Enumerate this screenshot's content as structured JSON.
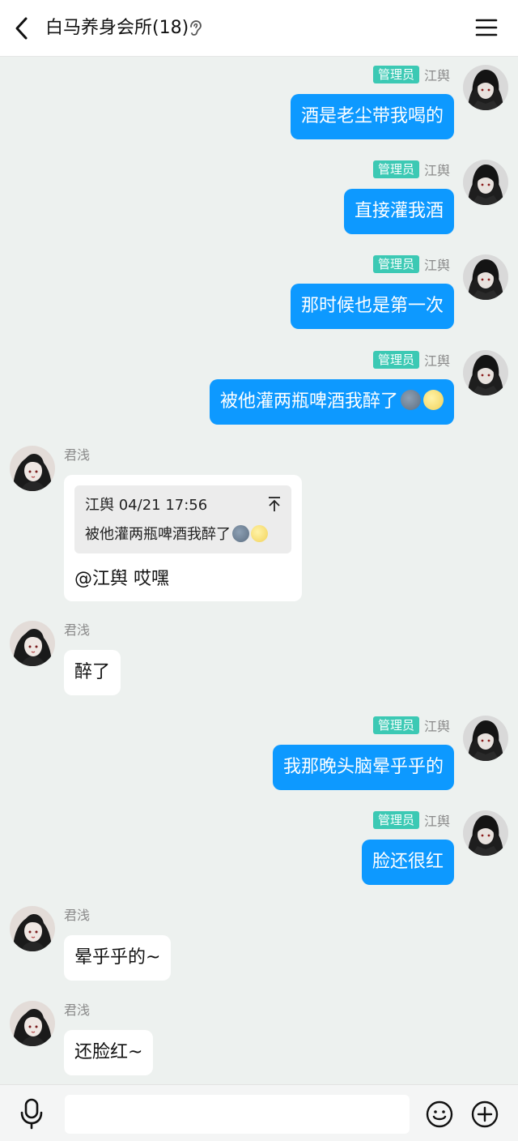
{
  "header": {
    "title": "白马养身会所(18)",
    "back_icon": "chevron-left-icon",
    "ear_icon": "ear-icon",
    "menu_icon": "hamburger-menu-icon"
  },
  "labels": {
    "admin": "管理员"
  },
  "colors": {
    "outgoing_bubble": "#0d99ff",
    "incoming_bubble": "#ffffff",
    "admin_badge": "#3cc9b4",
    "background": "#edf1ef"
  },
  "messages": [
    {
      "side": "right",
      "sender": "江舆",
      "admin": true,
      "text": "酒是老尘带我喝的",
      "emojis": []
    },
    {
      "side": "right",
      "sender": "江舆",
      "admin": true,
      "text": "直接灌我酒",
      "emojis": []
    },
    {
      "side": "right",
      "sender": "江舆",
      "admin": true,
      "text": "那时候也是第一次",
      "emojis": []
    },
    {
      "side": "right",
      "sender": "江舆",
      "admin": true,
      "text": "被他灌两瓶啤酒我醉了",
      "emojis": [
        "new-moon-face",
        "full-moon-face"
      ]
    },
    {
      "side": "left",
      "sender": "君浅",
      "admin": false,
      "quote": {
        "header": "江舆 04/21 17:56",
        "text": "被他灌两瓶啤酒我醉了",
        "emojis": [
          "new-moon-face",
          "full-moon-face"
        ],
        "icon": "jump-to-top-icon"
      },
      "text": "@江舆 哎嘿"
    },
    {
      "side": "left",
      "sender": "君浅",
      "admin": false,
      "text": "醉了",
      "emojis": []
    },
    {
      "side": "right",
      "sender": "江舆",
      "admin": true,
      "text": "我那晚头脑晕乎乎的",
      "emojis": []
    },
    {
      "side": "right",
      "sender": "江舆",
      "admin": true,
      "text": "脸还很红",
      "emojis": []
    },
    {
      "side": "left",
      "sender": "君浅",
      "admin": false,
      "text": "晕乎乎的~",
      "emojis": []
    },
    {
      "side": "left",
      "sender": "君浅",
      "admin": false,
      "text": "还脸红~",
      "emojis": []
    }
  ],
  "input_bar": {
    "placeholder": "",
    "mic_icon": "microphone-icon",
    "emoji_icon": "smiley-icon",
    "plus_icon": "plus-circle-icon"
  }
}
